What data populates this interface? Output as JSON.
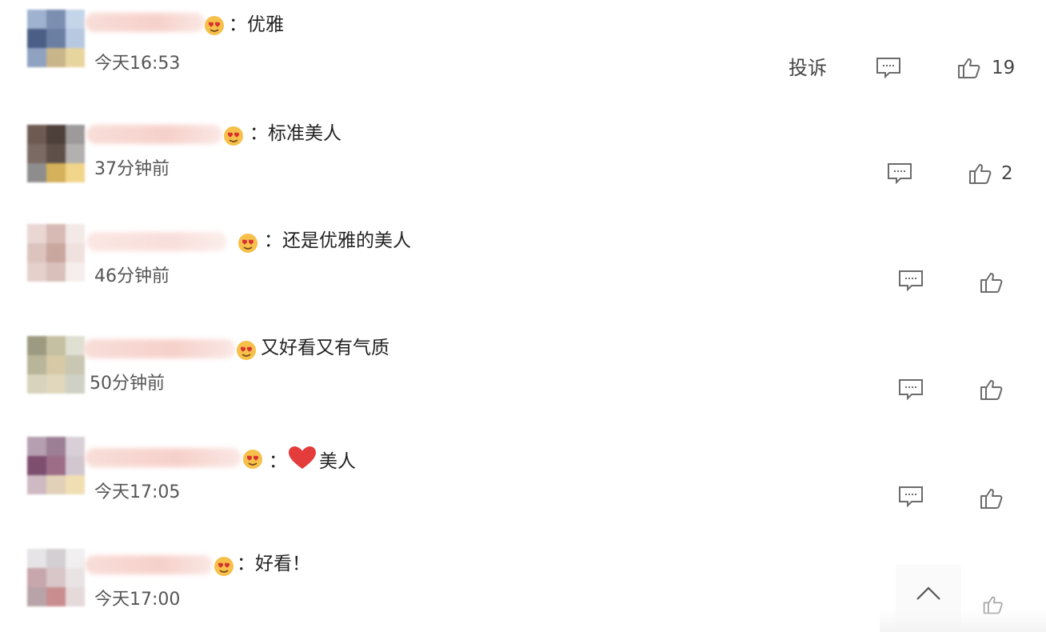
{
  "comments": [
    {
      "text": "：优雅",
      "time": "今天16:53",
      "report_label": "投诉",
      "likes": "19",
      "avatar_colors": [
        "#9fb3d0",
        "#7d8fb1",
        "#c4d5ea",
        "#4b5f86",
        "#6b7fa3",
        "#b7c9e1",
        "#8fa2c2",
        "#c9b58a",
        "#e7d59e"
      ]
    },
    {
      "text": "：标准美人",
      "time": "37分钟前",
      "likes": "2",
      "avatar_colors": [
        "#6e5a52",
        "#4d3f3a",
        "#9c9a9a",
        "#7a6a63",
        "#5e4f49",
        "#b3b0b0",
        "#8e8d8d",
        "#d4b15a",
        "#f1d58a"
      ]
    },
    {
      "text": "：还是优雅的美人",
      "time": "46分钟前",
      "likes": "",
      "avatar_colors": [
        "#ead7d4",
        "#d8bab4",
        "#f3e9e7",
        "#dcc3be",
        "#c9a79f",
        "#efe1de",
        "#e6d0cc",
        "#d9c0ba",
        "#f6eeec"
      ]
    },
    {
      "text": "又好看又有气质",
      "time": "50分钟前",
      "likes": "",
      "avatar_colors": [
        "#9c9a80",
        "#c5c0a2",
        "#dfe0d2",
        "#b9b59a",
        "#d7c9a6",
        "#c9c7b2",
        "#d8d3bd",
        "#e0d7bd",
        "#cfd1c4"
      ]
    },
    {
      "text": "美人",
      "time": "今天17:05",
      "likes": "",
      "avatar_colors": [
        "#b59fb0",
        "#9c7e95",
        "#d8d0d6",
        "#7e4e6f",
        "#9d6d88",
        "#d2c7cf",
        "#cfb9c2",
        "#e2d1b9",
        "#f1dfb3"
      ]
    },
    {
      "text": "：好看！",
      "time": "今天17:00",
      "likes": "",
      "avatar_colors": [
        "#e6e4e6",
        "#d4cfd2",
        "#f1eff0",
        "#c7a7ac",
        "#d8c6c9",
        "#e9e3e4",
        "#b8a4a8",
        "#c98d8f",
        "#e5d9da"
      ]
    }
  ],
  "colors": {
    "heart": "#e43b3b",
    "emoji_face": "#f6c04a",
    "icon_stroke": "#6b6b6b"
  },
  "icons": {
    "reply": "comment-bubble-icon",
    "like": "thumbs-up-icon",
    "scroll_top": "chevron-up-icon",
    "emoji": "heart-eyes-emoji-icon"
  }
}
